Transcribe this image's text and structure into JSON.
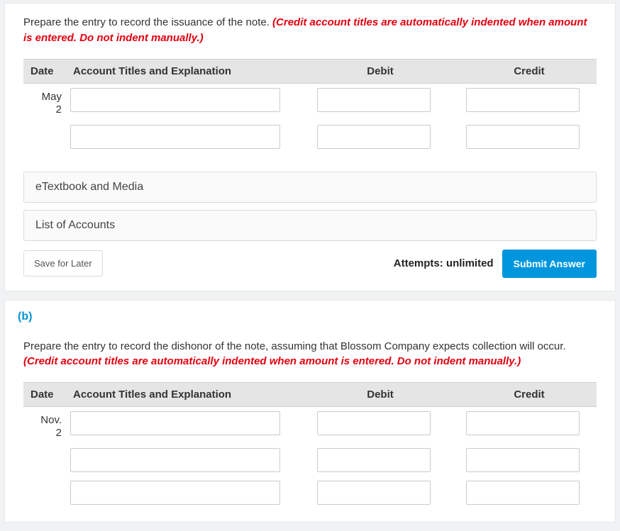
{
  "partA": {
    "instruction_plain": "Prepare the entry to record the issuance of the note. ",
    "instruction_red": "(Credit account titles are automatically indented when amount is entered. Do not indent manually.)",
    "headers": {
      "date": "Date",
      "acct": "Account Titles and Explanation",
      "debit": "Debit",
      "credit": "Credit"
    },
    "date_month": "May",
    "date_day": "2",
    "accordion": {
      "etext": "eTextbook and Media",
      "loa": "List of Accounts"
    },
    "save_label": "Save for Later",
    "attempts_label": "Attempts: unlimited",
    "submit_label": "Submit Answer"
  },
  "partB": {
    "label": "(b)",
    "instruction_plain": "Prepare the entry to record the dishonor of the note, assuming that Blossom Company expects collection will occur. ",
    "instruction_red": "(Credit account titles are automatically indented when amount is entered. Do not indent manually.)",
    "headers": {
      "date": "Date",
      "acct": "Account Titles and Explanation",
      "debit": "Debit",
      "credit": "Credit"
    },
    "date_month": "Nov.",
    "date_day": "2"
  }
}
